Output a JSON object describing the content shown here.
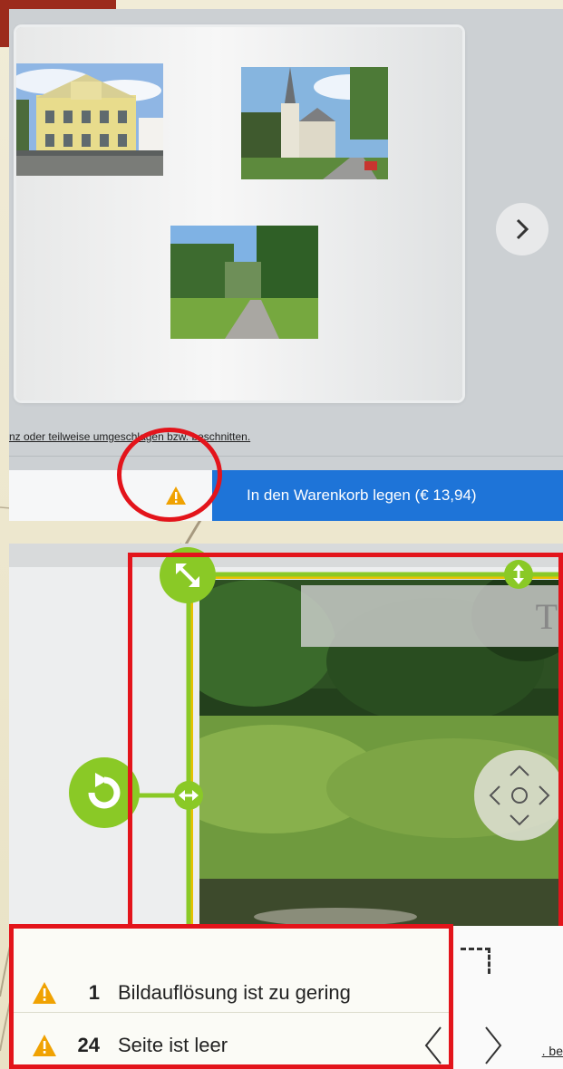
{
  "top_view": {
    "caption_text": "nz oder teilweise umgeschlagen bzw. beschnitten.",
    "cart_button_label": "In den Warenkorb legen (€ 13,94)",
    "icons": [
      "warning-icon",
      "chevron-right-icon"
    ]
  },
  "bottom_view": {
    "text_placeholder": "T",
    "right_edge_text": ". be",
    "warnings": [
      {
        "count": "1",
        "text": "Bildauflösung ist zu gering"
      },
      {
        "count": "24",
        "text": "Seite ist leer"
      }
    ],
    "icons": [
      "resize-diagonal-icon",
      "resize-vertical-icon",
      "resize-horizontal-icon",
      "rotate-icon",
      "move-pad-icon",
      "chevron-left-icon",
      "chevron-right-icon"
    ]
  },
  "colors": {
    "cart_button": "#1e74d8",
    "warning": "#f0a202",
    "annotation_red": "#e3141b",
    "handle_green": "#8ac926",
    "selection_yellow": "#e6c200"
  }
}
